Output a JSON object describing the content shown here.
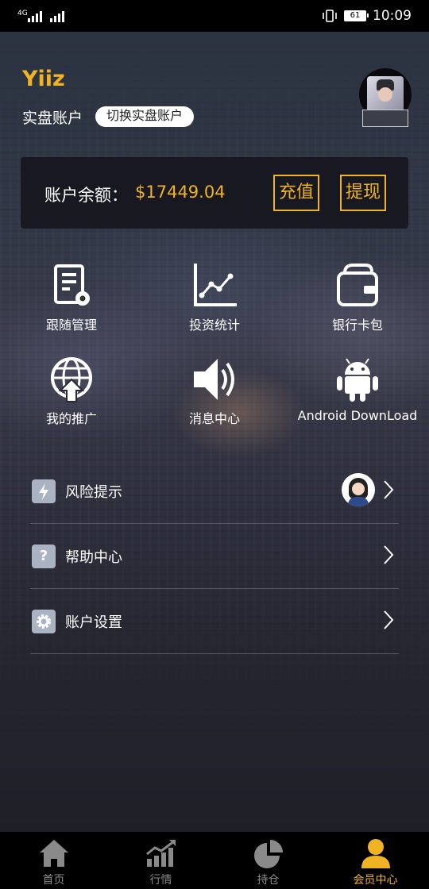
{
  "status_bar": {
    "network": "4G",
    "battery": "61",
    "time": "10:09"
  },
  "profile": {
    "username": "Yiiz",
    "account_type": "实盘账户",
    "switch_label": "切换实盘账户"
  },
  "balance": {
    "label": "账户余额：",
    "value": "$17449.04",
    "recharge_label": "充值",
    "withdraw_label": "提现"
  },
  "grid": [
    {
      "label": "跟随管理",
      "icon": "document-gear-icon"
    },
    {
      "label": "投资统计",
      "icon": "line-chart-icon"
    },
    {
      "label": "银行卡包",
      "icon": "wallet-icon"
    },
    {
      "label": "我的推广",
      "icon": "globe-upload-icon"
    },
    {
      "label": "消息中心",
      "icon": "speaker-icon"
    },
    {
      "label": "Android DownLoad",
      "icon": "android-icon"
    }
  ],
  "menu": [
    {
      "label": "风险提示",
      "icon": "lightning-icon"
    },
    {
      "label": "帮助中心",
      "icon": "question-icon"
    },
    {
      "label": "账户设置",
      "icon": "gear-icon"
    }
  ],
  "tabs": [
    {
      "label": "首页",
      "icon": "home-icon",
      "active": false
    },
    {
      "label": "行情",
      "icon": "market-chart-icon",
      "active": false
    },
    {
      "label": "持仓",
      "icon": "pie-chart-icon",
      "active": false
    },
    {
      "label": "会员中心",
      "icon": "user-icon",
      "active": true
    }
  ],
  "colors": {
    "accent": "#f0b323",
    "tab_inactive": "#8a8a8a",
    "menu_icon_bg": "#aab3c2"
  }
}
